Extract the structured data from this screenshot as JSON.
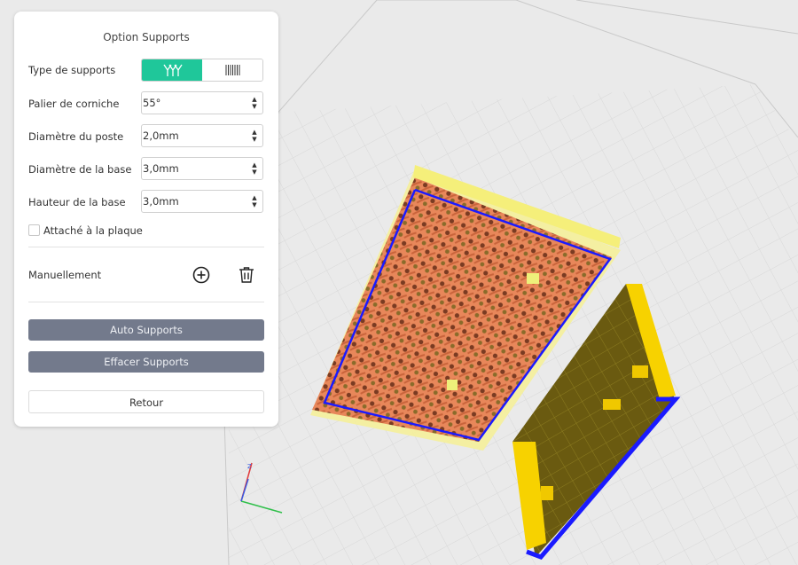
{
  "panel": {
    "title": "Option Supports",
    "support_type": {
      "label": "Type de supports",
      "options": [
        "tree-supports-icon",
        "grid-supports-icon"
      ],
      "selected": "tree-supports-icon"
    },
    "fields": [
      {
        "label": "Palier de corniche",
        "value": "55°"
      },
      {
        "label": "Diamètre du poste",
        "value": "2,0mm"
      },
      {
        "label": "Diamètre de la base",
        "value": "3,0mm"
      },
      {
        "label": "Hauteur de la base",
        "value": "3,0mm"
      }
    ],
    "attach_plate": {
      "label": "Attaché à la plaque",
      "checked": false
    },
    "manual": {
      "label": "Manuellement"
    },
    "buttons": {
      "auto": "Auto Supports",
      "clear": "Effacer Supports",
      "back": "Retour"
    }
  },
  "colors": {
    "accent": "#1fc79a",
    "button_dark": "#737a8c",
    "support_orange": "#e8875a",
    "support_brown": "#7a3b22",
    "model_yellow": "#f0c800",
    "model_edge_blue": "#1a1aff"
  },
  "axis": {
    "z": "Z"
  }
}
